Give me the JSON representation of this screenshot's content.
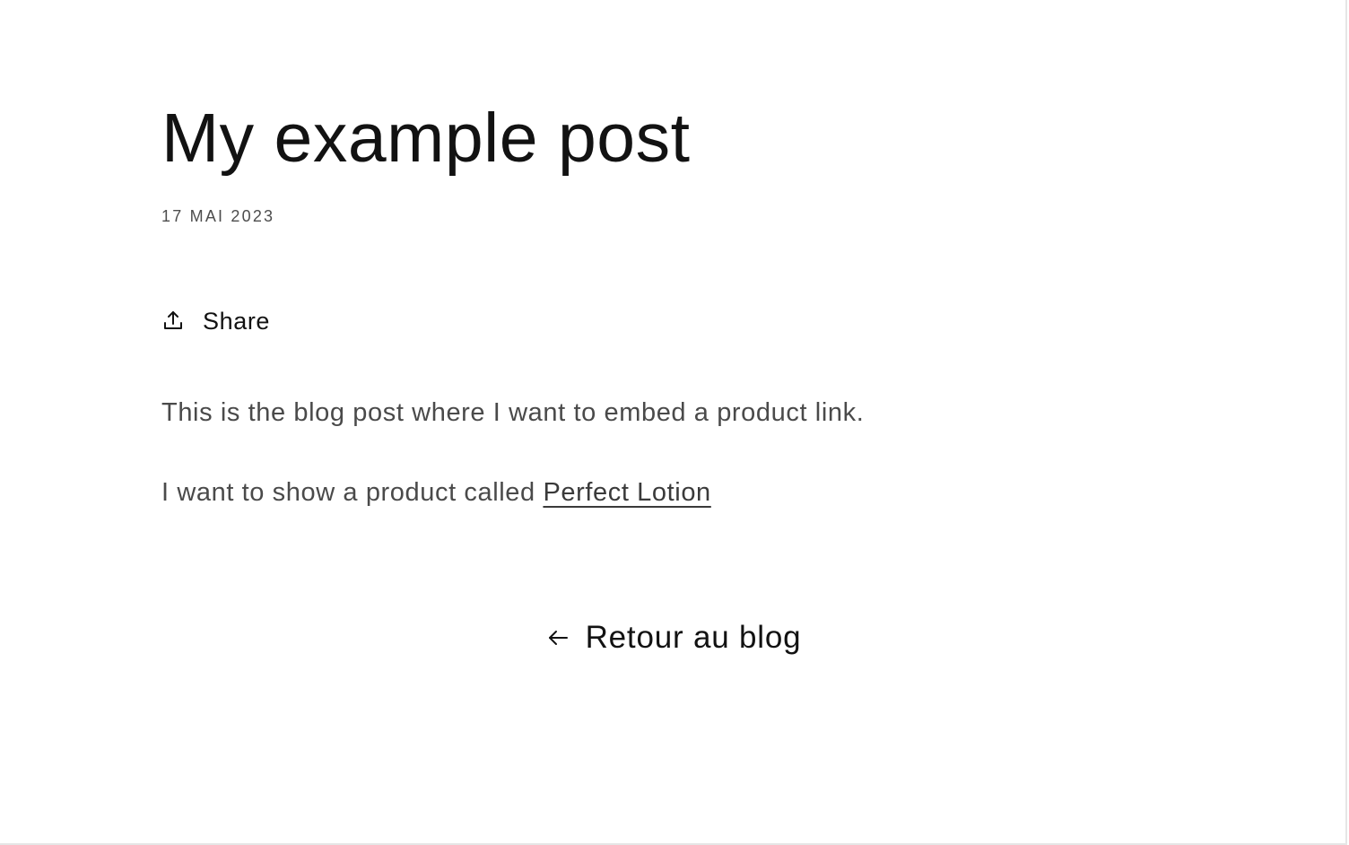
{
  "article": {
    "title": "My example post",
    "date": "17 MAI 2023",
    "share": {
      "label": "Share",
      "icon": "share-icon"
    },
    "body": {
      "paragraph_1": "This is the blog post where I want to embed a product link.",
      "paragraph_2_prefix": "I want to show a product called ",
      "product_link": "Perfect Lotion"
    }
  },
  "footer_nav": {
    "back_label": "Retour au blog",
    "back_icon": "arrow-left-icon"
  },
  "colors": {
    "text_primary": "#121212",
    "text_body": "#4a4a4a",
    "text_muted": "#4d4d4d",
    "background": "#ffffff"
  }
}
